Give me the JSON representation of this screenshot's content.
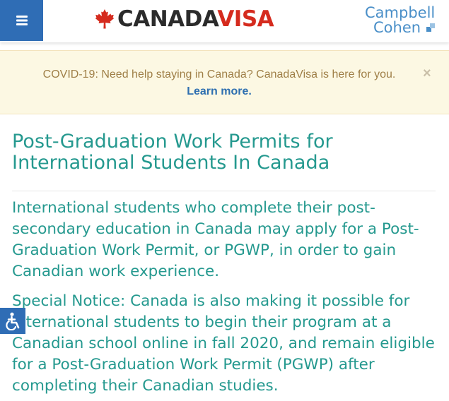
{
  "header": {
    "logo": {
      "part1": "CANADA",
      "part2": "VISA"
    },
    "partner_logo": {
      "line1": "Campbell",
      "line2": "Cohen"
    }
  },
  "alert": {
    "message": "COVID-19: Need help staying in Canada? CanadaVisa is here for you.",
    "link_label": "Learn more.",
    "close_symbol": "×"
  },
  "main": {
    "title": "Post-Graduation Work Permits for International Students In Canada",
    "intro": "International students who complete their post-secondary education in Canada may apply for a Post-Graduation Work Permit, or PGWP, in order to gain Canadian work experience.",
    "notice": "Special Notice: Canada is also making it possible for international students to begin their program at a Canadian school online in fall 2020, and remain eligible for a Post-Graduation Work Permit (PGWP) after completing their Canadian studies."
  },
  "icons": {
    "menu": "hamburger-icon",
    "maple_leaf": "maple-leaf-icon",
    "accessibility": "accessibility-icon"
  },
  "colors": {
    "primary": "#2f6db5",
    "heading": "#25998f",
    "brand_red": "#d52b1e",
    "alert_bg": "#fcf8e3",
    "alert_text": "#9f7f47",
    "link": "#2e6fb0"
  }
}
